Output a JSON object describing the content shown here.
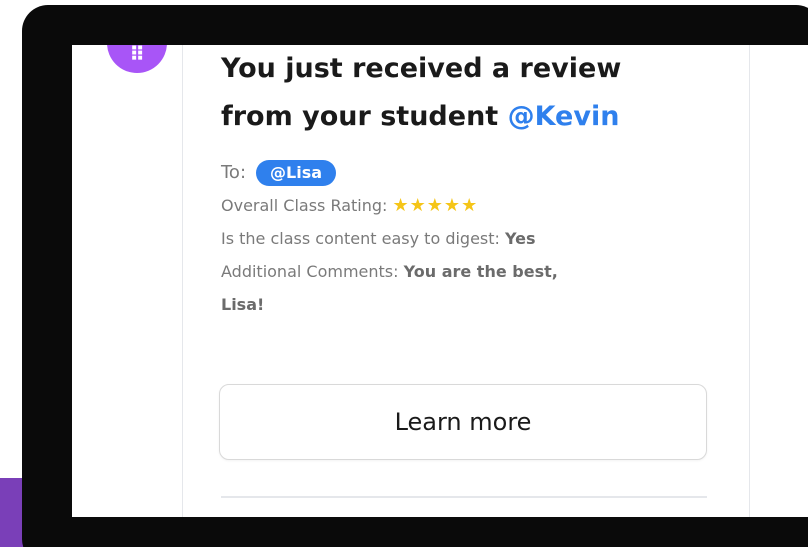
{
  "avatar": {
    "icon": "list-icon",
    "glyph": "⠿",
    "color": "#a855f7"
  },
  "notification": {
    "title_line1": "You just received a review",
    "title_line2_prefix": "from your student ",
    "student_mention": "@Kevin",
    "to_label": "To:",
    "recipient_mention": "@Lisa",
    "rating_label": "Overall Class Rating:",
    "rating_stars": "★★★★★",
    "rating_value": 5,
    "rating_max": 5,
    "digest_label": "Is the class content easy to digest:",
    "digest_value": "Yes",
    "comments_label": "Additional Comments:",
    "comments_value_line1": "You are the best,",
    "comments_value_line2": "Lisa!"
  },
  "actions": {
    "learn_more_label": "Learn more"
  },
  "colors": {
    "accent": "#2f80ed",
    "avatar": "#a855f7",
    "frame": "#0a0a0a",
    "side_edge": "#7a3fb8"
  }
}
